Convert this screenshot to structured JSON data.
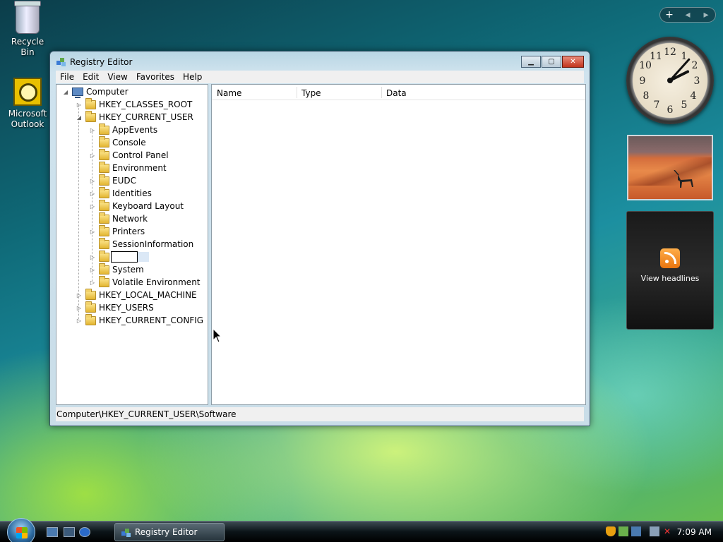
{
  "desktop": {
    "icons": [
      {
        "label": "Recycle Bin"
      },
      {
        "label": "Microsoft Outlook"
      }
    ]
  },
  "window": {
    "title": "Registry Editor",
    "menu": [
      "File",
      "Edit",
      "View",
      "Favorites",
      "Help"
    ],
    "tree": {
      "root": "Computer",
      "hkcr": "HKEY_CLASSES_ROOT",
      "hkcu": "HKEY_CURRENT_USER",
      "hkcu_children": [
        "AppEvents",
        "Console",
        "Control Panel",
        "Environment",
        "EUDC",
        "Identities",
        "Keyboard Layout",
        "Network",
        "Printers",
        "SessionInformation",
        "",
        "System",
        "Volatile Environment"
      ],
      "hklm": "HKEY_LOCAL_MACHINE",
      "hku": "HKEY_USERS",
      "hkcc": "HKEY_CURRENT_CONFIG"
    },
    "columns": [
      "Name",
      "Type",
      "Data"
    ],
    "status": "Computer\\HKEY_CURRENT_USER\\Software"
  },
  "gadgets": {
    "feed_label": "View headlines",
    "clock": {
      "hour": 2,
      "minute": 7
    }
  },
  "taskbar": {
    "task": "Registry Editor",
    "time": "7:09 AM"
  },
  "colors": {
    "accent": "#2c6aa0",
    "folder": "#e3b531"
  }
}
